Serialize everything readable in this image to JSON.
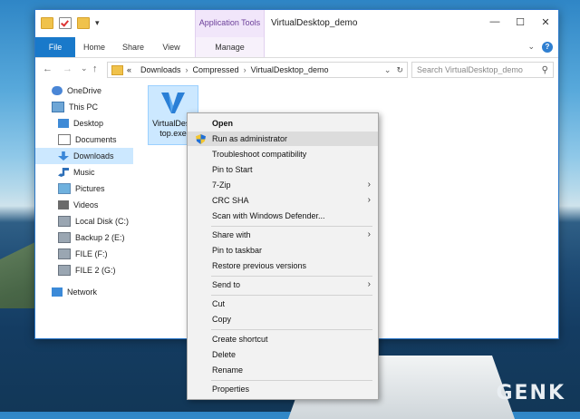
{
  "window": {
    "title": "VirtualDesktop_demo",
    "contextual_group": "Application Tools",
    "quick_access_more": "▾"
  },
  "ribbon": {
    "tabs": [
      {
        "label": "File"
      },
      {
        "label": "Home"
      },
      {
        "label": "Share"
      },
      {
        "label": "View"
      },
      {
        "label": "Manage"
      }
    ],
    "expand_glyph": "⌄"
  },
  "address": {
    "prefix": "«",
    "crumbs": [
      "Downloads",
      "Compressed",
      "VirtualDesktop_demo"
    ],
    "search_placeholder": "Search VirtualDesktop_demo"
  },
  "nav_pane": {
    "items": [
      {
        "label": "OneDrive",
        "icon": "cloud-icon"
      },
      {
        "label": "This PC",
        "icon": "computer-icon"
      },
      {
        "label": "Desktop",
        "icon": "desktop-icon"
      },
      {
        "label": "Documents",
        "icon": "documents-icon"
      },
      {
        "label": "Downloads",
        "icon": "downloads-icon",
        "selected": true
      },
      {
        "label": "Music",
        "icon": "music-icon"
      },
      {
        "label": "Pictures",
        "icon": "pictures-icon"
      },
      {
        "label": "Videos",
        "icon": "videos-icon"
      },
      {
        "label": "Local Disk (C:)",
        "icon": "disk-icon"
      },
      {
        "label": "Backup 2 (E:)",
        "icon": "disk-icon"
      },
      {
        "label": "FILE (F:)",
        "icon": "disk-icon"
      },
      {
        "label": "FILE 2 (G:)",
        "icon": "disk-icon"
      },
      {
        "label": "Network",
        "icon": "network-icon"
      }
    ]
  },
  "files": [
    {
      "name": "VirtualDesk\ntop.exe",
      "icon": "virtualdesktop-exe-icon",
      "selected": true
    }
  ],
  "context_menu": {
    "items": [
      {
        "label": "Open",
        "bold": true
      },
      {
        "label": "Run as administrator",
        "icon": "uac-shield-icon",
        "hover": true
      },
      {
        "label": "Troubleshoot compatibility"
      },
      {
        "label": "Pin to Start"
      },
      {
        "label": "7-Zip",
        "submenu": true
      },
      {
        "label": "CRC SHA",
        "submenu": true
      },
      {
        "label": "Scan with Windows Defender..."
      },
      {
        "separator": true
      },
      {
        "label": "Share with",
        "submenu": true
      },
      {
        "label": "Pin to taskbar"
      },
      {
        "label": "Restore previous versions"
      },
      {
        "separator": true
      },
      {
        "label": "Send to",
        "submenu": true
      },
      {
        "separator": true
      },
      {
        "label": "Cut"
      },
      {
        "label": "Copy"
      },
      {
        "separator": true
      },
      {
        "label": "Create shortcut"
      },
      {
        "label": "Delete"
      },
      {
        "label": "Rename"
      },
      {
        "separator": true
      },
      {
        "label": "Properties"
      }
    ]
  },
  "watermark": "GENK",
  "colors": {
    "accent": "#1979ca",
    "selection": "#cce8ff",
    "contextual_tab": "#f1e6fa"
  }
}
